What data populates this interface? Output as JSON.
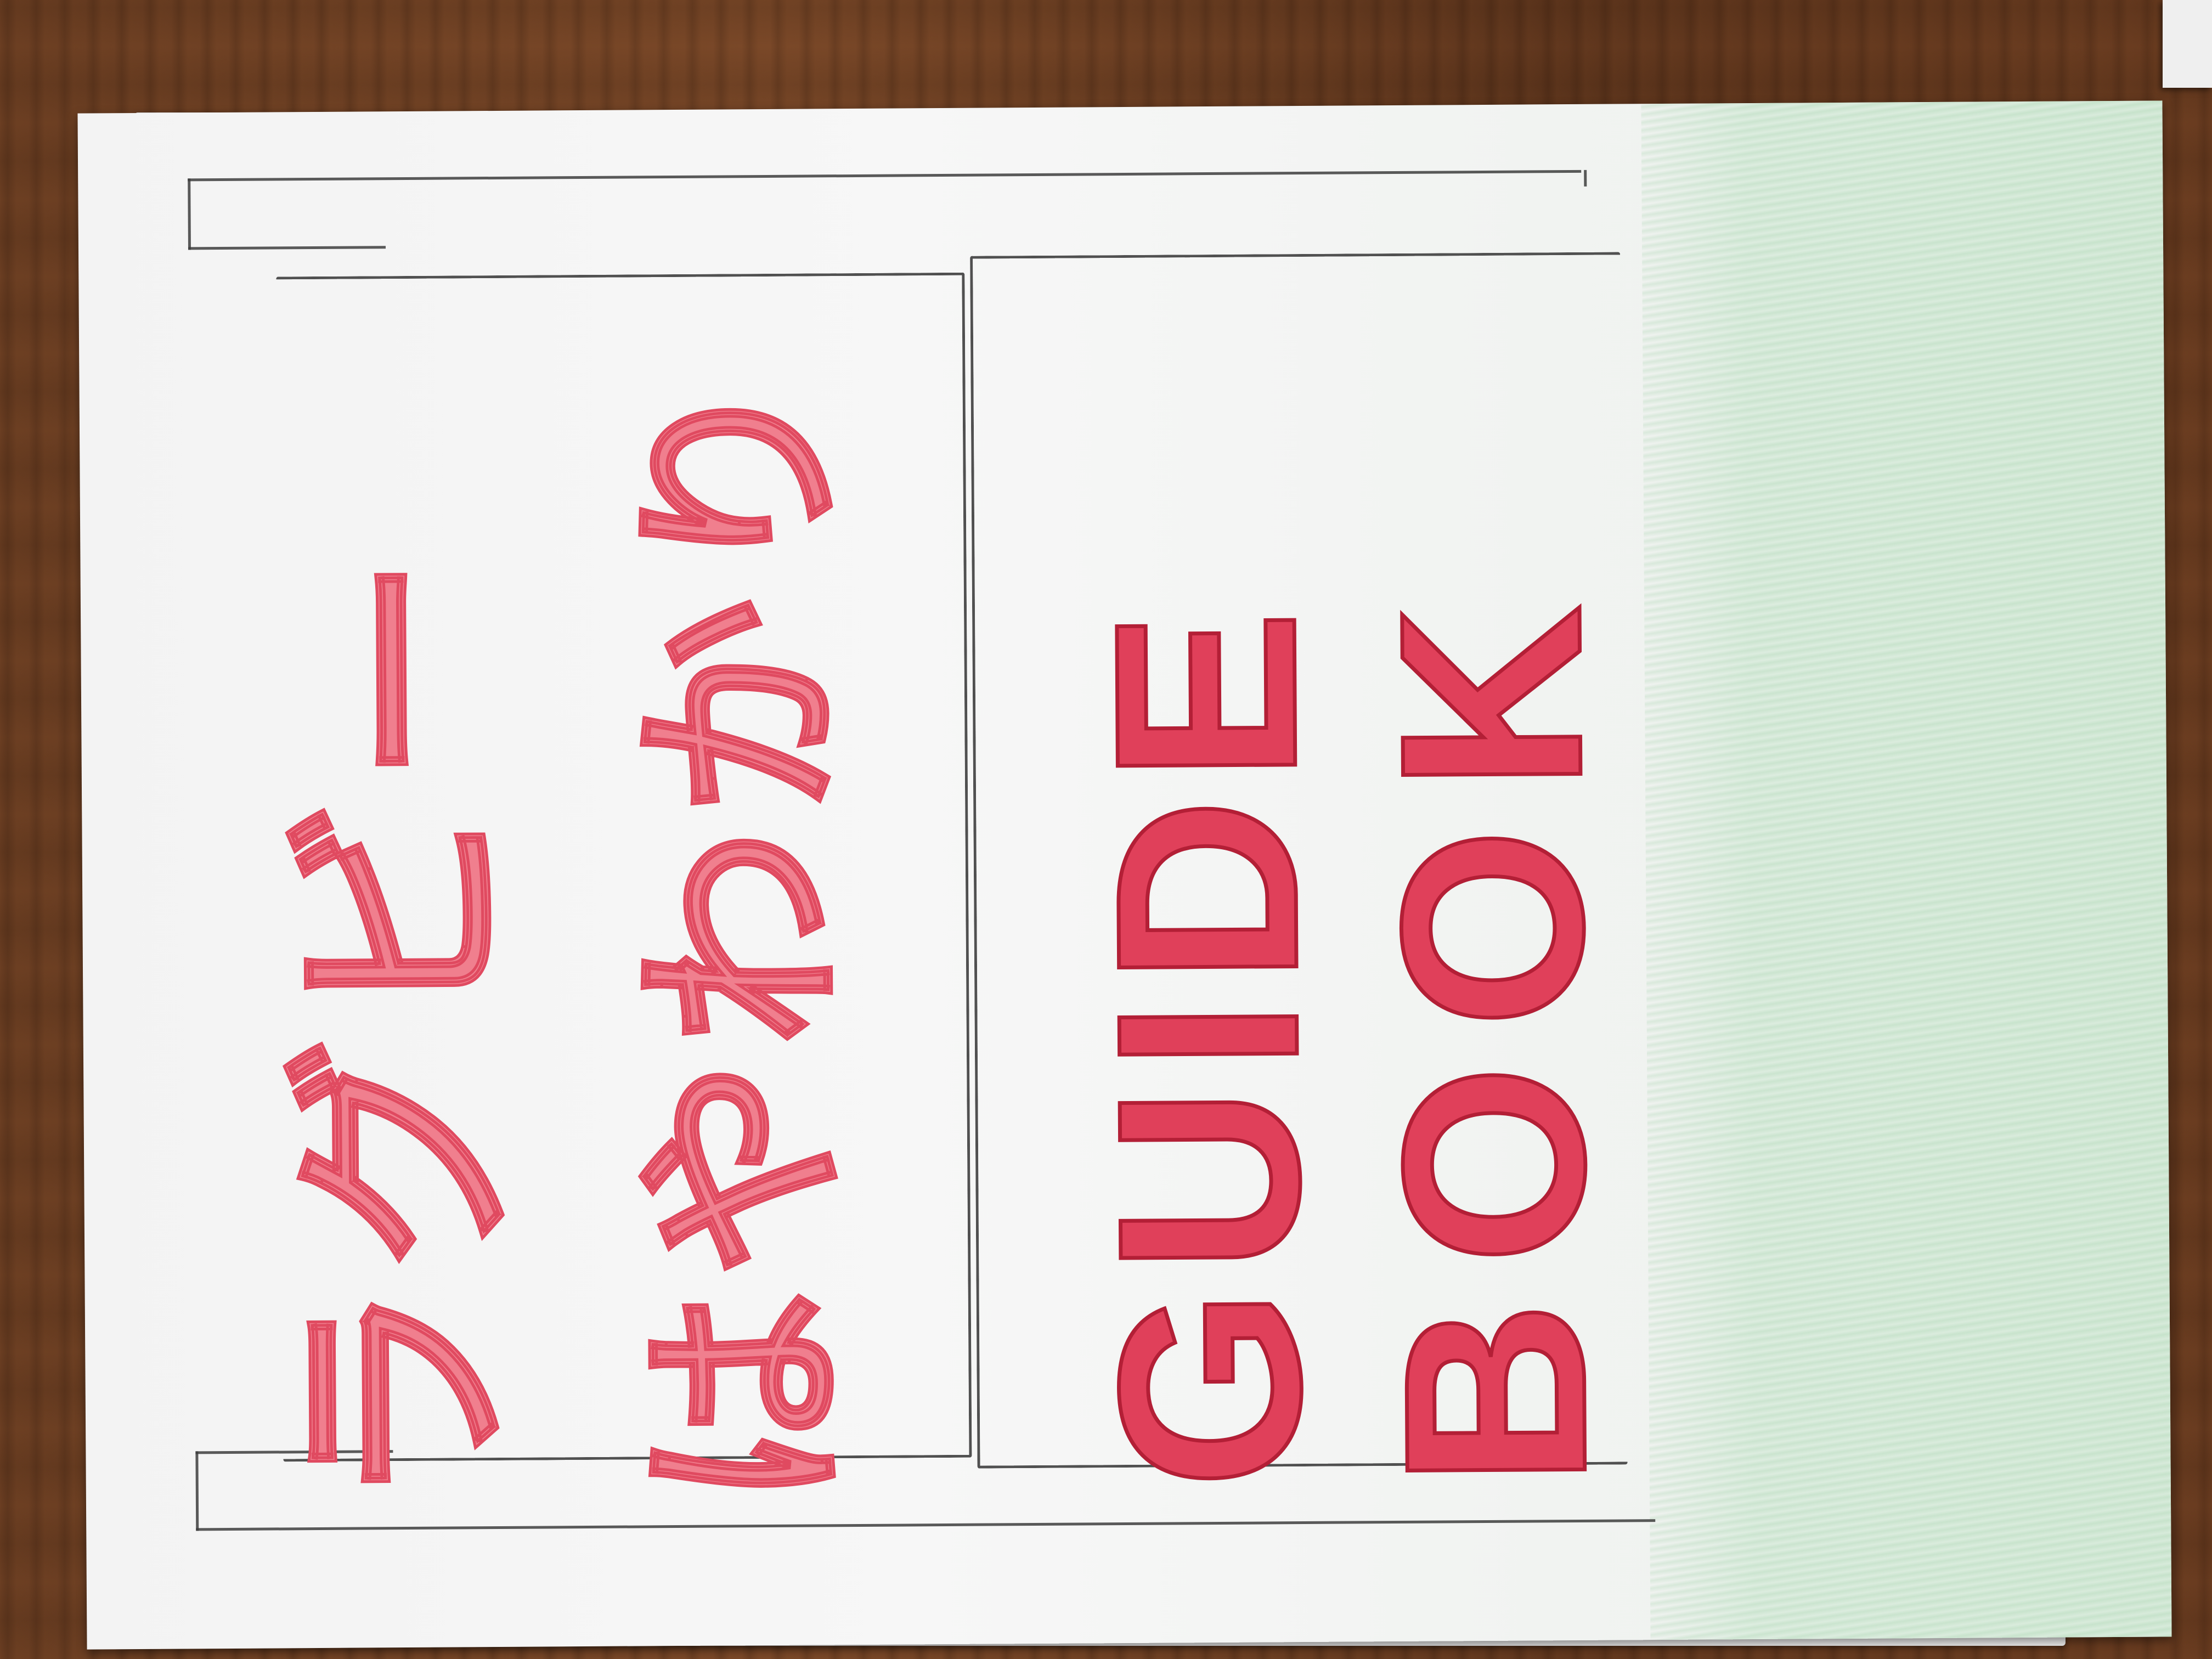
{
  "scene": {
    "surface": "wooden desk",
    "object": "hand-drawn booklet cover"
  },
  "cover": {
    "title_jp_line1": "ラグビー",
    "title_jp_line2": "はやわかり",
    "title_en_line1": "GUIDE",
    "title_en_line2": "BOOK",
    "orientation": "rotated 90° counter-clockwise"
  },
  "colors": {
    "title_red": "#e0405a",
    "title_pink": "#f07f8e",
    "pencil": "#3f3f3f",
    "green_crayon": "#b9e0c0",
    "wood": "#6b3e22"
  }
}
